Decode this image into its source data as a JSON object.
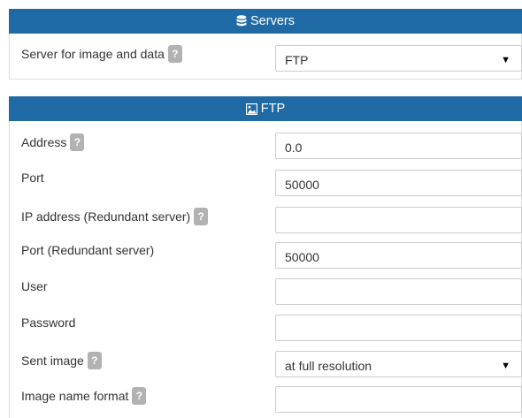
{
  "servers_panel": {
    "title": "Servers",
    "title_icon": "database-icon",
    "server_label": "Server for image and data",
    "server_value": "FTP"
  },
  "ftp_panel": {
    "title": "FTP",
    "title_icon": "image-icon",
    "fields": {
      "address": {
        "label": "Address",
        "value": "0.0"
      },
      "port": {
        "label": "Port",
        "value": "50000"
      },
      "ip_redundant": {
        "label": "IP address (Redundant server)",
        "value": ""
      },
      "port_redundant": {
        "label": "Port (Redundant server)",
        "value": "50000"
      },
      "user": {
        "label": "User",
        "value": ""
      },
      "password": {
        "label": "Password",
        "value": ""
      },
      "sent_image": {
        "label": "Sent image",
        "value": "at full resolution"
      },
      "image_name_format": {
        "label": "Image name format",
        "value": ""
      }
    }
  },
  "help_icon_text": "?",
  "select_arrow": "▼",
  "colors": {
    "header_bg": "#1f6aa5",
    "header_text": "#ffffff",
    "help_badge": "#b2b2b2"
  }
}
